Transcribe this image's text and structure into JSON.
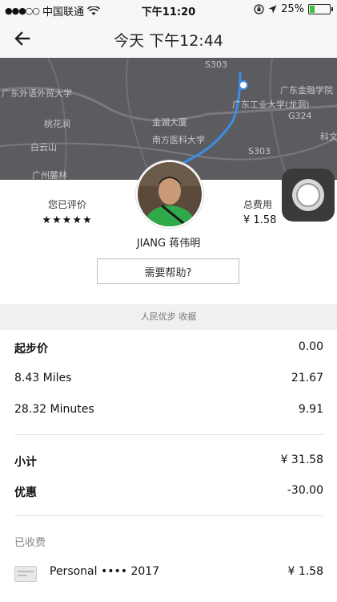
{
  "status_bar": {
    "signal_dots": "●●●○○",
    "carrier": "中国联通",
    "time": "下午11:20",
    "battery_percent": "25%",
    "battery_level": 0.25
  },
  "header": {
    "title": "今天 下午12:44"
  },
  "map": {
    "labels": [
      "广东外语外贸大学",
      "桃花涧",
      "白云山",
      "广州麓林",
      "金湖大厦",
      "南方医科大学",
      "广东工业大学(龙洞)",
      "广东金融学院",
      "S303",
      "S303",
      "G324",
      "科文"
    ]
  },
  "rating": {
    "label": "您已评价",
    "stars": "★★★★★"
  },
  "total": {
    "label": "总费用",
    "value": "¥ 1.58"
  },
  "driver": {
    "name": "JIANG 蒋伟明"
  },
  "help_button": "需要帮助?",
  "receipt": {
    "header": "人民优步 收据",
    "base_fare_label": "起步价",
    "base_fare_value": "0.00",
    "distance_label": "8.43 Miles",
    "distance_value": "21.67",
    "time_label": "28.32 Minutes",
    "time_value": "9.91",
    "subtotal_label": "小计",
    "subtotal_value": "¥ 31.58",
    "discount_label": "优惠",
    "discount_value": "-30.00",
    "collected_label": "已收费",
    "payment_label": "Personal •••• 2017",
    "payment_value": "¥ 1.58"
  }
}
